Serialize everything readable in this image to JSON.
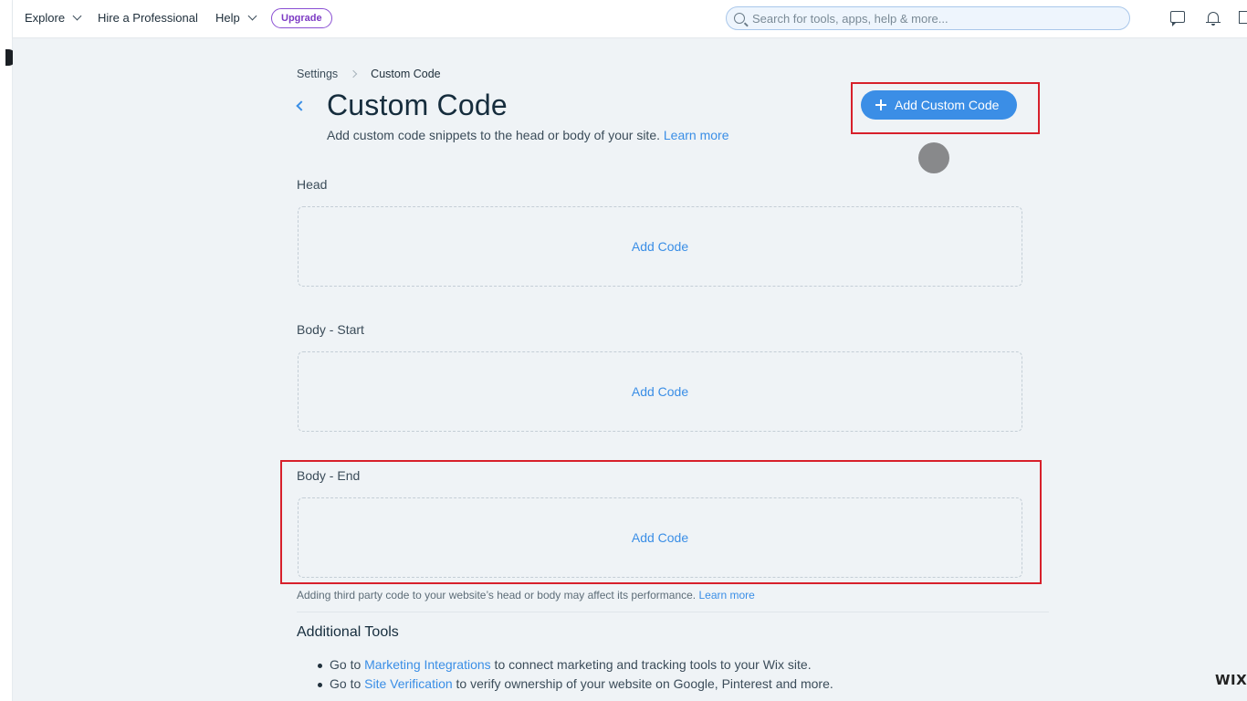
{
  "topbar": {
    "nav": [
      {
        "label": "Explore",
        "has_dropdown": true
      },
      {
        "label": "Hire a Professional",
        "has_dropdown": false
      },
      {
        "label": "Help",
        "has_dropdown": true
      }
    ],
    "upgrade_label": "Upgrade",
    "search_placeholder": "Search for tools, apps, help & more...",
    "icons": [
      "chat-icon",
      "bell-icon",
      "panel-icon"
    ]
  },
  "breadcrumb": {
    "parent": "Settings",
    "current": "Custom Code"
  },
  "page": {
    "title": "Custom Code",
    "subtitle": "Add custom code snippets to the head or body of your site.",
    "subtitle_link": "Learn more",
    "add_button_label": "Add Custom Code"
  },
  "sections": [
    {
      "label": "Head",
      "action": "Add Code"
    },
    {
      "label": "Body - Start",
      "action": "Add Code"
    },
    {
      "label": "Body - End",
      "action": "Add Code"
    }
  ],
  "performance_note": {
    "text": "Adding third party code to your website’s head or body may affect its performance.",
    "link": "Learn more"
  },
  "additional_tools": {
    "title": "Additional Tools",
    "items": [
      {
        "prefix": "Go to ",
        "link": "Marketing Integrations",
        "suffix": " to connect marketing and tracking tools to your Wix site."
      },
      {
        "prefix": "Go to ",
        "link": "Site Verification",
        "suffix": " to verify ownership of your website on Google, Pinterest and more."
      }
    ]
  },
  "watermark": "WIX",
  "colors": {
    "accent": "#3b8ee6",
    "highlight": "#d7202b",
    "upgrade": "#7d3bc4",
    "background": "#eff3f6"
  }
}
